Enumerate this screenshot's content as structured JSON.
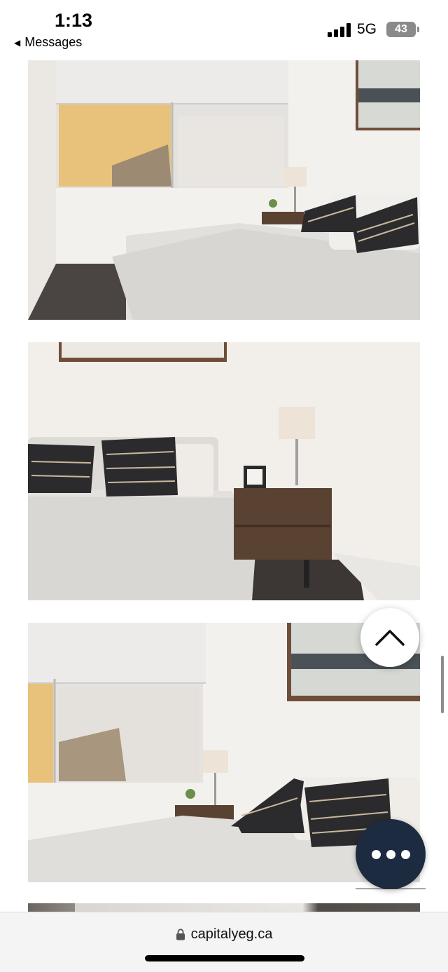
{
  "status_bar": {
    "time": "1:13",
    "back_label": "Messages",
    "network": "5G",
    "battery": "43"
  },
  "gallery": {
    "photos": [
      {
        "name": "bedroom-photo-1"
      },
      {
        "name": "bedroom-photo-2"
      },
      {
        "name": "bedroom-photo-3"
      }
    ]
  },
  "browser": {
    "url": "capitalyeg.ca"
  },
  "colors": {
    "fab": "#1c2b3f",
    "pillow_dark": "#2b2b2e",
    "nightstand": "#5a4232"
  },
  "icons": {
    "back": "back-caret-icon",
    "signal": "signal-icon",
    "battery": "battery-icon",
    "lock": "lock-icon",
    "scroll_top": "chevron-up-icon",
    "more": "more-dots-icon"
  }
}
